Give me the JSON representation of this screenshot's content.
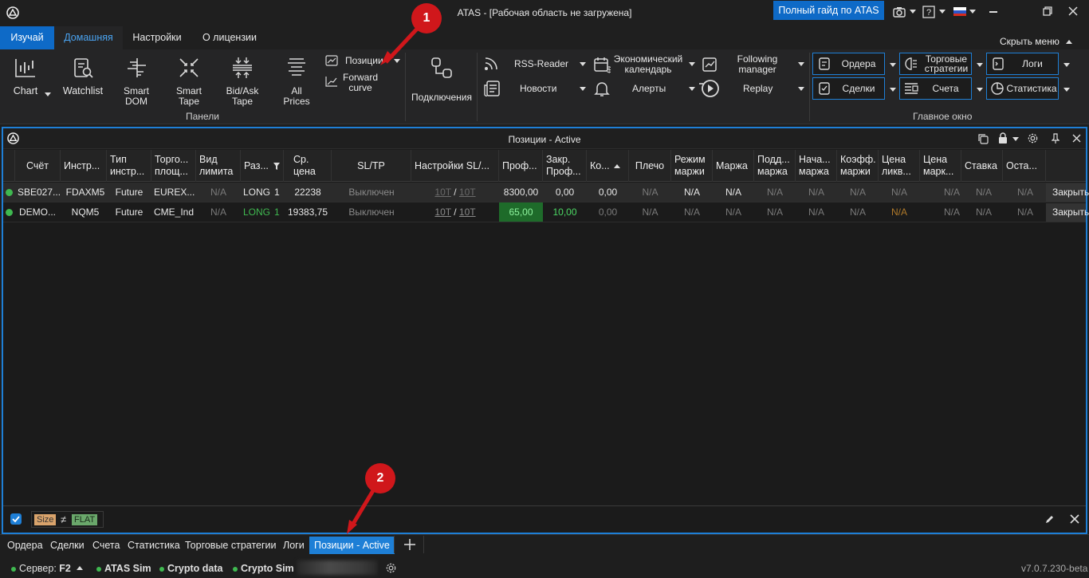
{
  "window": {
    "title": "ATAS - [Рабочая область не загружена]",
    "guide_button": "Полный гайд по ATAS"
  },
  "menu": {
    "tabs": [
      "Изучай",
      "Домашняя",
      "Настройки",
      "О лицензии"
    ],
    "hide_menu": "Скрыть меню"
  },
  "ribbon": {
    "panels": {
      "chart": "Chart",
      "watchlist": "Watchlist",
      "smart_dom": [
        "Smart",
        "DOM"
      ],
      "smart_tape": [
        "Smart",
        "Tape"
      ],
      "bid_ask_tape": [
        "Bid/Ask",
        "Tape"
      ],
      "all_prices": [
        "All",
        "Prices"
      ],
      "positions": "Позиции",
      "forward_curve": [
        "Forward",
        "curve"
      ],
      "group_label": "Панели"
    },
    "connections": "Подключения",
    "tools": {
      "rss": "RSS-Reader",
      "news": "Новости",
      "econ_calendar": [
        "Экономический",
        "календарь"
      ],
      "alerts": "Алерты",
      "following_manager": [
        "Following",
        "manager"
      ],
      "replay": "Replay"
    },
    "main_window": {
      "orders": "Ордера",
      "trades": "Сделки",
      "strategies": [
        "Торговые",
        "стратегии"
      ],
      "accounts": "Счета",
      "logs": "Логи",
      "statistics": "Статистика",
      "group_label": "Главное окно"
    }
  },
  "panel": {
    "title": "Позиции - Active",
    "columns": [
      [
        "Счёт"
      ],
      [
        "Инстр..."
      ],
      [
        "Тип",
        "инстр..."
      ],
      [
        "Торго...",
        "площ..."
      ],
      [
        "Вид",
        "лимита"
      ],
      [
        "Раз..."
      ],
      [
        "Ср.",
        "цена"
      ],
      [
        "SL/TP"
      ],
      [
        "Настройки SL/..."
      ],
      [
        "Проф..."
      ],
      [
        "Закр.",
        "Проф..."
      ],
      [
        "Ко..."
      ],
      [
        "Плечо"
      ],
      [
        "Режим",
        "маржи"
      ],
      [
        "Маржа"
      ],
      [
        "Подд...",
        "маржа"
      ],
      [
        "Нача...",
        "маржа"
      ],
      [
        "Коэфф.",
        "маржи"
      ],
      [
        "Цена",
        "ликв..."
      ],
      [
        "Цена",
        "марк..."
      ],
      [
        "Ставка"
      ],
      [
        "Оста..."
      ]
    ],
    "rows": [
      {
        "account": "SBE027...",
        "instrument": "FDAXM5",
        "type": "Future",
        "exchange": "EUREX...",
        "limit_type": "N/A",
        "side": "LONG",
        "size": "1",
        "avg_price": "22238",
        "sltp": "Выключен",
        "sltp_a": "10T",
        "sltp_b": "10T",
        "profit": "8300,00",
        "closed_profit": "0,00",
        "commission": "0,00",
        "leverage": "N/A",
        "margin_mode": "N/A",
        "margin": "N/A",
        "maint_margin": "N/A",
        "init_margin": "N/A",
        "margin_coef": "N/A",
        "liq_price": "N/A",
        "mark_price": "N/A",
        "rate": "N/A",
        "rest": "N/A",
        "close": "Закрыть"
      },
      {
        "account": "DEMO...",
        "instrument": "NQM5",
        "type": "Future",
        "exchange": "CME_Ind",
        "limit_type": "N/A",
        "side": "LONG",
        "size": "1",
        "avg_price": "19383,75",
        "sltp": "Выключен",
        "sltp_a": "10T",
        "sltp_b": "10T",
        "profit": "65,00",
        "closed_profit": "10,00",
        "commission": "0,00",
        "leverage": "N/A",
        "margin_mode": "N/A",
        "margin": "N/A",
        "maint_margin": "N/A",
        "init_margin": "N/A",
        "margin_coef": "N/A",
        "liq_price": "N/A",
        "mark_price": "N/A",
        "rate": "N/A",
        "rest": "N/A",
        "close": "Закрыть"
      }
    ],
    "filter": {
      "field": "Size",
      "op": "≠",
      "value": "FLAT"
    }
  },
  "bottom_tabs": [
    "Ордера",
    "Сделки",
    "Счета",
    "Статистика",
    "Торговые стратегии",
    "Логи",
    "Позиции - Active"
  ],
  "status": {
    "server_label": "Сервер:",
    "server": "F2",
    "conn1": "ATAS Sim",
    "conn2": "Crypto data",
    "conn3": "Crypto Sim",
    "version": "v7.0.7.230-beta"
  },
  "markers": [
    "1",
    "2"
  ],
  "colors": {
    "accent": "#1e7fd6",
    "guide_button": "#0e6ac7",
    "profit_green": "#3fb950",
    "marker_red": "#d0171b"
  }
}
